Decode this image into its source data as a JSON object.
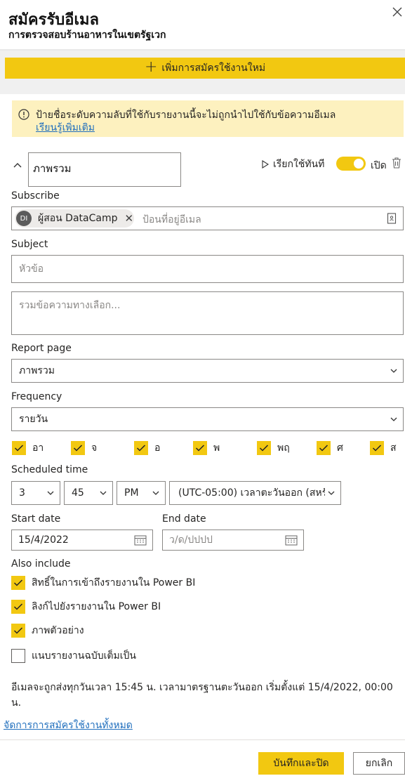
{
  "header": {
    "title": "สมัครรับอีเมล",
    "subtitle": "การตรวจสอบร้านอาหารในเขตรัฐเวก"
  },
  "add_subscription_label": "เพิ่มการสมัครใช้งานใหม่",
  "warning": {
    "text": "ป้ายชื่อระดับความลับที่ใช้กับรายงานนี้จะไม่ถูกนำไปใช้กับข้อความอีเมล",
    "link": "เรียนรู้เพิ่มเติม"
  },
  "subscription": {
    "name": "ภาพรวม",
    "run_now_label": "เรียกใช้ทันที",
    "toggle_label": "เปิด",
    "toggle_on": true
  },
  "subscribe": {
    "label": "Subscribe",
    "recipient": {
      "initials": "DI",
      "name": "ผู้สอน DataCamp"
    },
    "placeholder": "ป้อนที่อยู่อีเมล"
  },
  "subject": {
    "label": "Subject",
    "placeholder": "หัวข้อ"
  },
  "message": {
    "placeholder": "รวมข้อความทางเลือก..."
  },
  "report_page": {
    "label": "Report page",
    "value": "ภาพรวม"
  },
  "frequency": {
    "label": "Frequency",
    "value": "รายวัน"
  },
  "days": [
    {
      "label": "อา",
      "checked": true
    },
    {
      "label": "จ",
      "checked": true
    },
    {
      "label": "อ",
      "checked": true
    },
    {
      "label": "พ",
      "checked": true
    },
    {
      "label": "พฤ",
      "checked": true
    },
    {
      "label": "ศ",
      "checked": true
    },
    {
      "label": "ส",
      "checked": true
    }
  ],
  "scheduled_time": {
    "label": "Scheduled time",
    "hour": "3",
    "minute": "45",
    "ampm": "PM",
    "timezone": "(UTC-05:00) เวลาตะวันออก (สหรัฐ"
  },
  "start_date": {
    "label": "Start date",
    "value": "15/4/2022"
  },
  "end_date": {
    "label": "End date",
    "placeholder": "ว/ด/ปปปป"
  },
  "also_include": {
    "label": "Also include",
    "items": [
      {
        "label": "สิทธิ์ในการเข้าถึงรายงานใน Power BI",
        "checked": true
      },
      {
        "label": "ลิงก์ไปยังรายงานใน Power BI",
        "checked": true
      },
      {
        "label": "ภาพตัวอย่าง",
        "checked": true
      },
      {
        "label": "แนบรายงานฉบับเต็มเป็น",
        "checked": false
      }
    ]
  },
  "summary": "อีเมลจะถูกส่งทุกวันเวลา 15:45 น. เวลามาตรฐานตะวันออก เริ่มตั้งแต่ 15/4/2022, 00:00 น.",
  "manage_link": "จัดการการสมัครใช้งานทั้งหมด",
  "footer": {
    "save_label": "บันทึกและปิด",
    "cancel_label": "ยกเลิก"
  },
  "colors": {
    "accent": "#f2c811",
    "link": "#1f6ebd",
    "warning_bg": "#fdf1bf"
  },
  "icons": [
    "close-icon",
    "plus-icon",
    "warning-icon",
    "chevron-up-icon",
    "play-icon",
    "trash-icon",
    "address-book-icon",
    "chevron-down-icon",
    "calendar-icon",
    "checkmark-icon"
  ]
}
